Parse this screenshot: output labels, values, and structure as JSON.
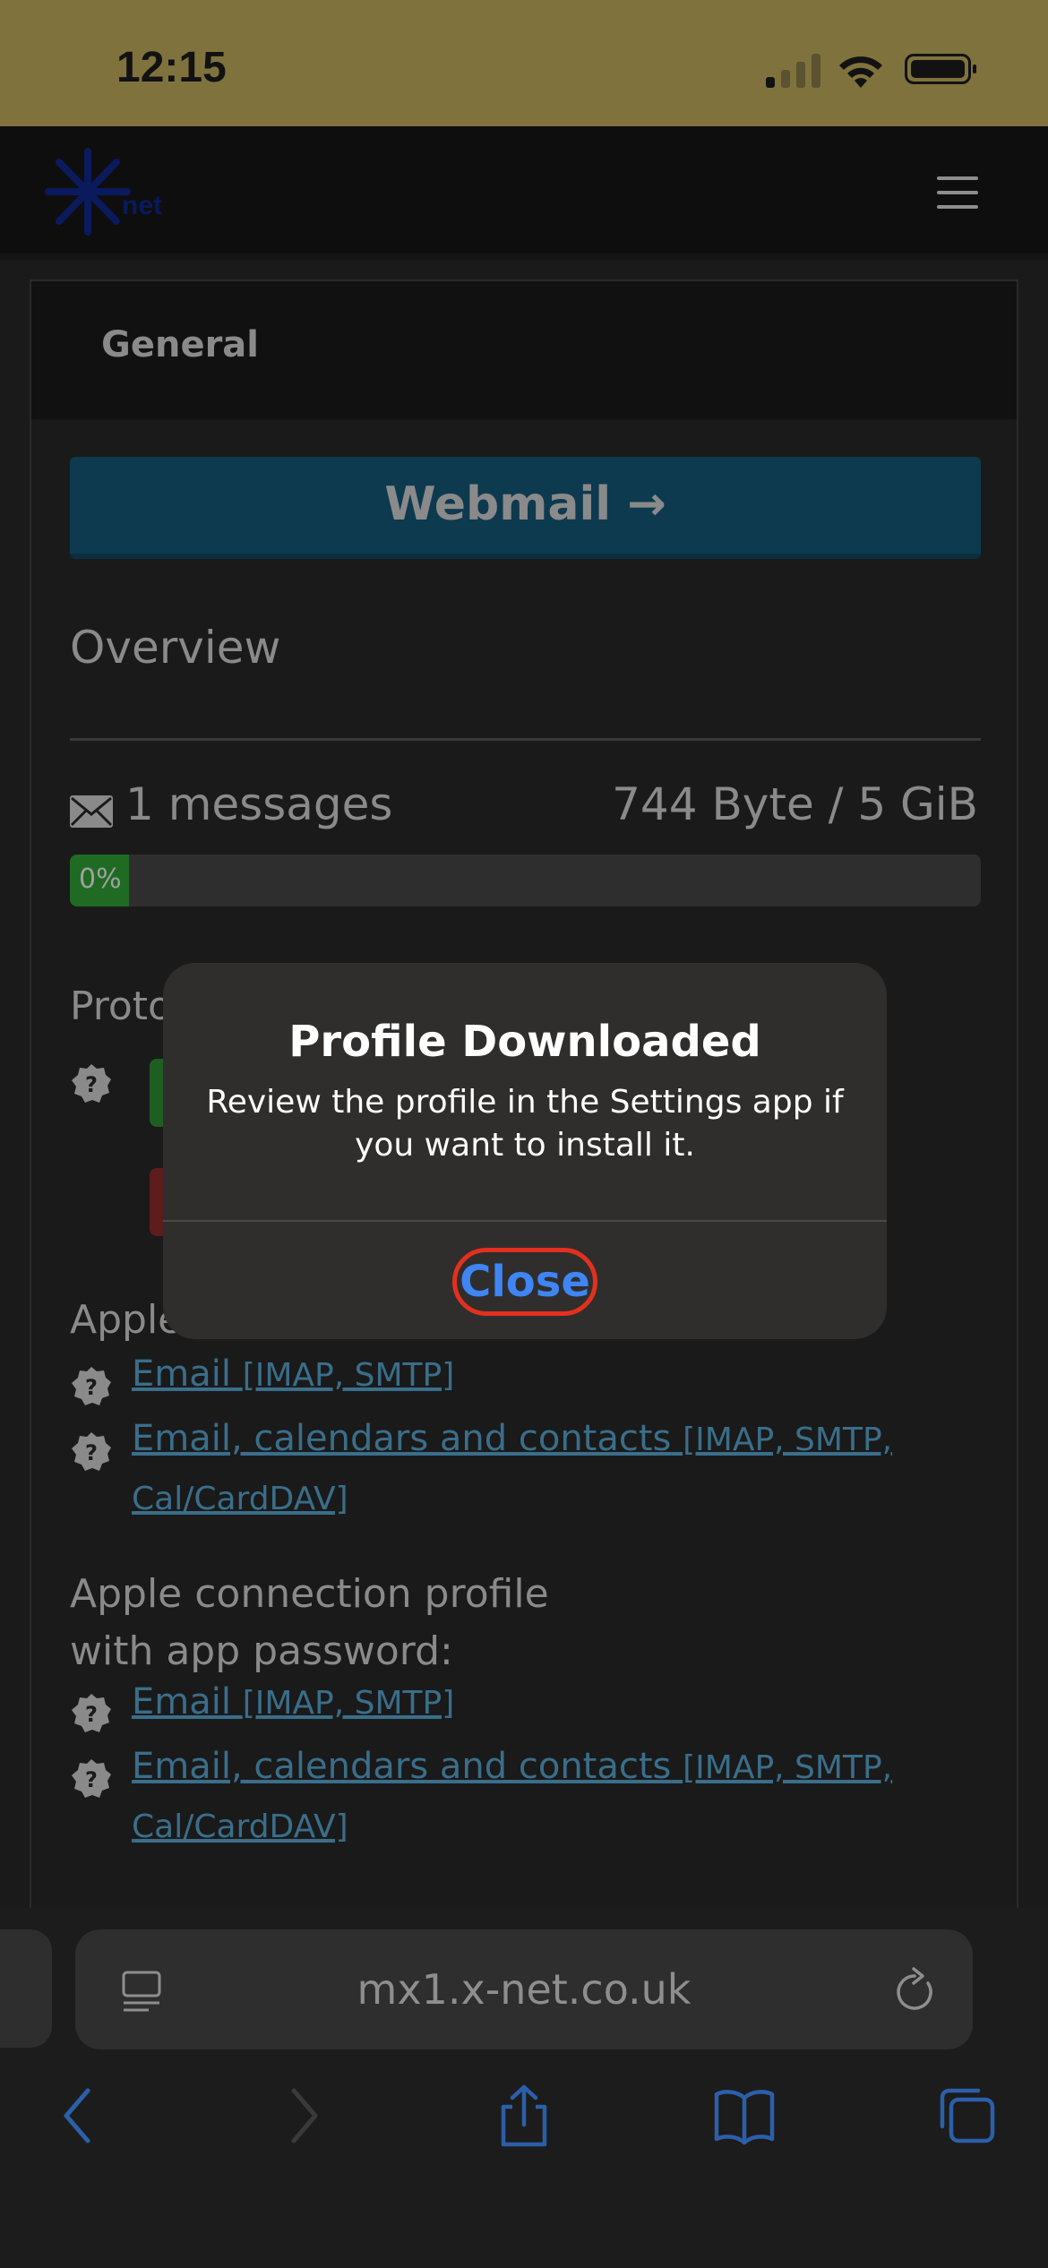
{
  "status_bar": {
    "time": "12:15",
    "signal_bars_active": 1,
    "signal_bars_total": 4,
    "colors": {
      "background": "#7f723d"
    }
  },
  "nav": {
    "logo_icon": "x-net-logo",
    "menu_icon": "hamburger-icon"
  },
  "card": {
    "header_title": "General",
    "webmail_button": "Webmail →",
    "overview_title": "Overview",
    "messages": "1 messages",
    "quota": "744 Byte / 5 GiB",
    "progress": {
      "label": "0%",
      "display_fraction": 0.065
    },
    "protocols_label": "Proto",
    "apple_label_partial": "Apple",
    "links_group1": [
      {
        "text": "Email",
        "tag": "[IMAP, SMTP]"
      },
      {
        "text": "Email, calendars and contacts",
        "tag": "[IMAP, SMTP,",
        "tag2": "Cal/CardDAV]"
      }
    ],
    "apple_app_password_label_line1": "Apple connection profile",
    "apple_app_password_label_line2": "with app password:",
    "links_group2": [
      {
        "text": "Email",
        "tag": "[IMAP, SMTP]"
      },
      {
        "text": "Email, calendars and contacts",
        "tag": "[IMAP, SMTP,",
        "tag2": "Cal/CardDAV]"
      }
    ]
  },
  "dialog": {
    "title": "Profile Downloaded",
    "message": "Review the profile in the Settings app if you want to install it.",
    "close_button": "Close",
    "colors": {
      "button_text": "#3f85f3",
      "highlight_ring": "#e3301e"
    }
  },
  "browser": {
    "url": "mx1.x-net.co.uk",
    "toolbar_icons": [
      "back-icon",
      "forward-icon",
      "share-icon",
      "bookmarks-icon",
      "tabs-icon"
    ]
  }
}
